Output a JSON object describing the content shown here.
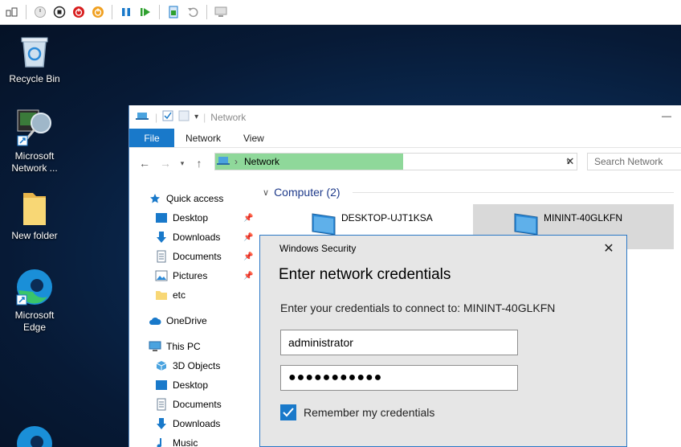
{
  "desktop": {
    "icons": [
      {
        "label": "Recycle Bin"
      },
      {
        "label": "Microsoft Network ..."
      },
      {
        "label": "New folder"
      },
      {
        "label": "Microsoft Edge"
      }
    ]
  },
  "explorer": {
    "title": "Network",
    "ribbon_tabs": [
      "File",
      "Network",
      "View"
    ],
    "address": "Network",
    "search_placeholder": "Search Network",
    "nav": {
      "quick_access": "Quick access",
      "quick_items": [
        {
          "label": "Desktop",
          "pinned": true
        },
        {
          "label": "Downloads",
          "pinned": true
        },
        {
          "label": "Documents",
          "pinned": true
        },
        {
          "label": "Pictures",
          "pinned": true
        },
        {
          "label": "etc",
          "pinned": false
        }
      ],
      "onedrive": "OneDrive",
      "this_pc": "This PC",
      "pc_items": [
        "3D Objects",
        "Desktop",
        "Documents",
        "Downloads",
        "Music"
      ]
    },
    "group": {
      "label": "Computer (2)",
      "computers": [
        {
          "name": "DESKTOP-UJT1KSA",
          "selected": false
        },
        {
          "name": "MININT-40GLKFN",
          "selected": true
        }
      ]
    }
  },
  "dialog": {
    "caption": "Windows Security",
    "title": "Enter network credentials",
    "message": "Enter your credentials to connect to: MININT-40GLKFN",
    "username": "administrator",
    "password_mask": "●●●●●●●●●●●",
    "remember_label": "Remember my credentials",
    "remember_checked": true
  },
  "colors": {
    "accent": "#1979ca",
    "address_highlight": "#8fd89a",
    "dialog_bg": "#e6e6e6"
  }
}
